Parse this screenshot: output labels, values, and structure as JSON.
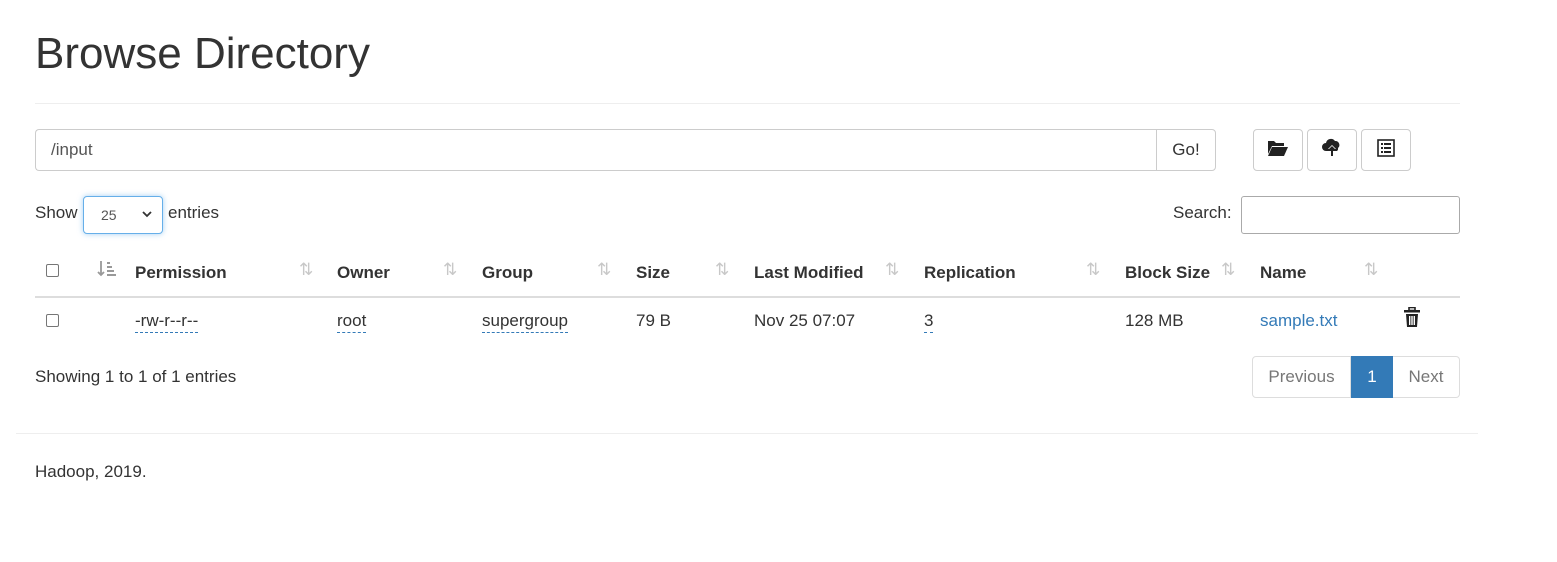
{
  "page": {
    "title": "Browse Directory"
  },
  "path_bar": {
    "value": "/input",
    "go_label": "Go!"
  },
  "toolbar": {
    "icons": [
      "folder-open-icon",
      "cloud-upload-icon",
      "list-icon"
    ]
  },
  "length_control": {
    "show_label": "Show",
    "selected": "25",
    "entries_label": "entries"
  },
  "search": {
    "label": "Search:",
    "value": ""
  },
  "table": {
    "columns": [
      "Permission",
      "Owner",
      "Group",
      "Size",
      "Last Modified",
      "Replication",
      "Block Size",
      "Name"
    ],
    "rows": [
      {
        "permission": "-rw-r--r--",
        "owner": "root",
        "group": "supergroup",
        "size": "79 B",
        "last_modified": "Nov 25 07:07",
        "replication": "3",
        "block_size": "128 MB",
        "name": "sample.txt"
      }
    ]
  },
  "info": "Showing 1 to 1 of 1 entries",
  "pagination": {
    "previous": "Previous",
    "current": "1",
    "next": "Next"
  },
  "footer": "Hadoop, 2019.",
  "colors": {
    "link": "#337ab7",
    "active_page": "#337ab7",
    "sort_icon": "#c8c8c8"
  }
}
